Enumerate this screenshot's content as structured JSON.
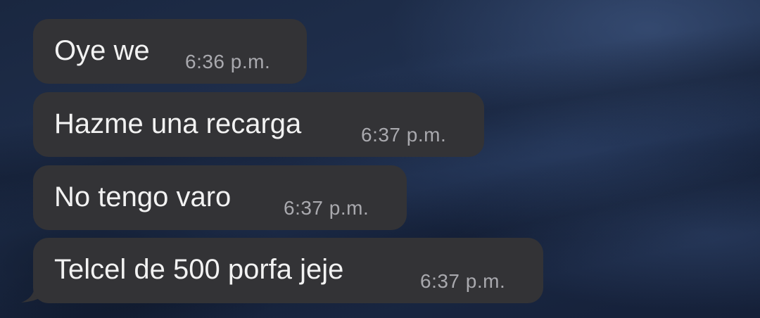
{
  "messages": [
    {
      "text": "Oye we",
      "time": "6:36 p.m."
    },
    {
      "text": "Hazme una recarga",
      "time": "6:37 p.m."
    },
    {
      "text": "No tengo varo",
      "time": "6:37 p.m."
    },
    {
      "text": "Telcel de 500 porfa jeje",
      "time": "6:37 p.m."
    }
  ],
  "colors": {
    "bubble": "#333336",
    "message_text": "#f2f2f2",
    "timestamp_text": "#a9a9ae",
    "wallpaper": "#1f2f4d"
  }
}
